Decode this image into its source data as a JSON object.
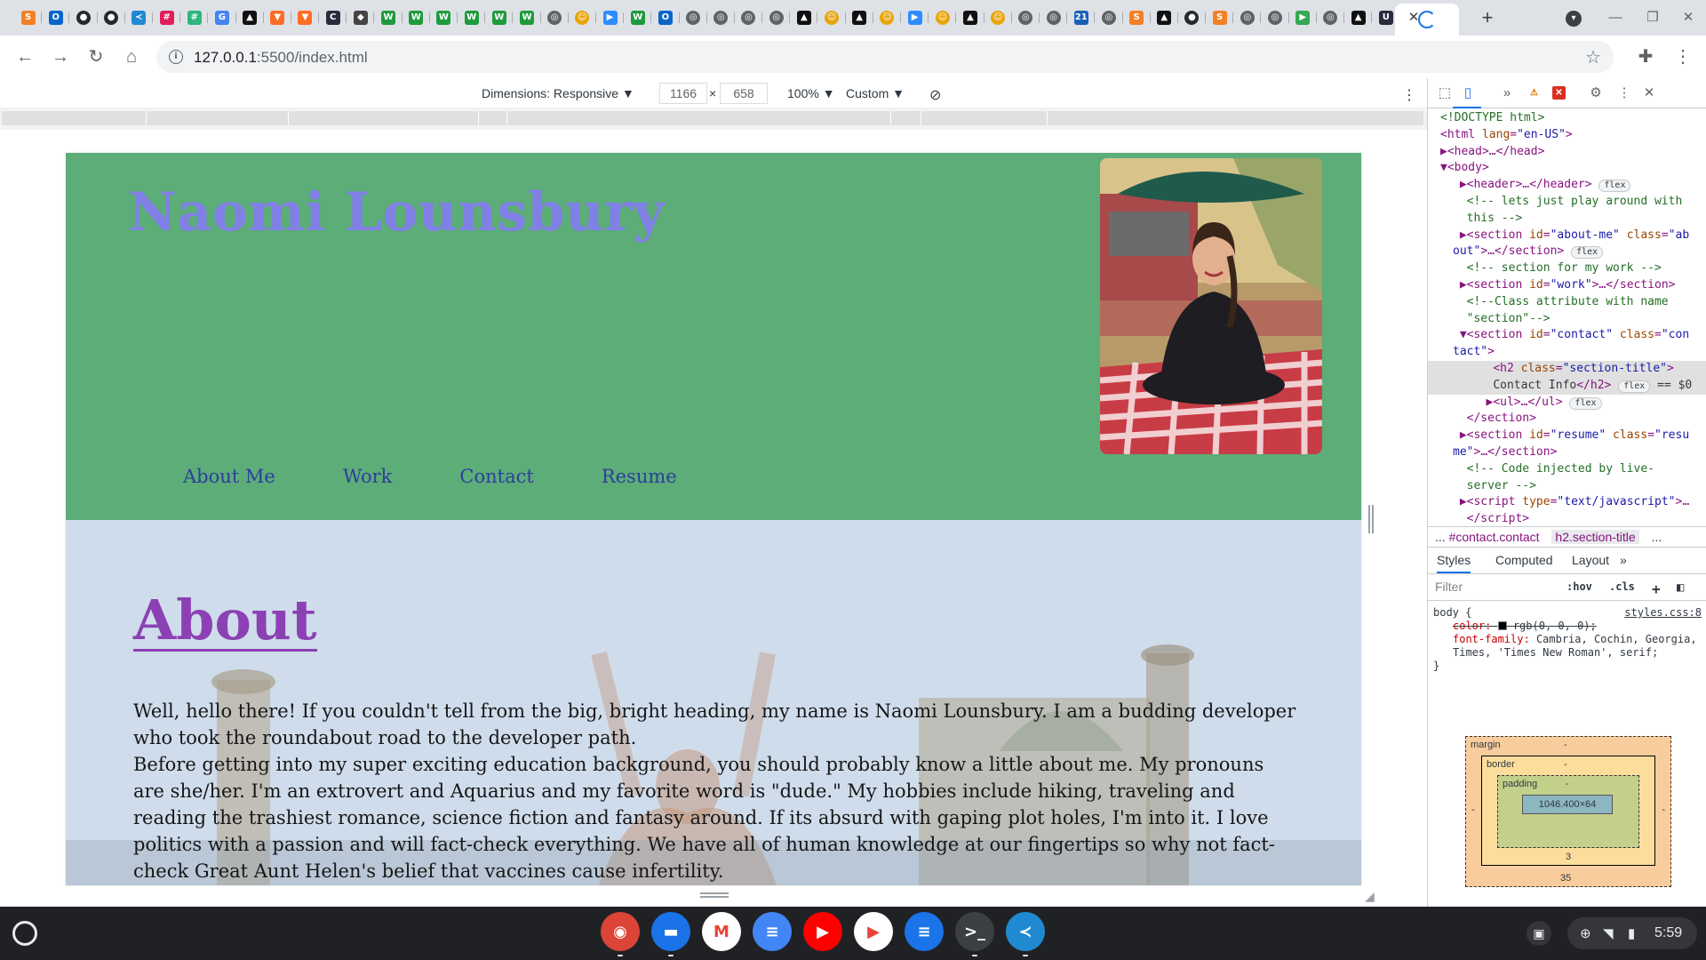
{
  "browser": {
    "tabs": [
      {
        "icon": "stackoverflow-icon",
        "glyph": "S",
        "color": "#f48024"
      },
      {
        "icon": "outlook-icon",
        "glyph": "O",
        "color": "#0a64c8"
      },
      {
        "icon": "github-icon",
        "glyph": "●",
        "color": "#24292e"
      },
      {
        "icon": "github-icon",
        "glyph": "●",
        "color": "#24292e"
      },
      {
        "icon": "vscode-icon",
        "glyph": "≺",
        "color": "#1f8ad2"
      },
      {
        "icon": "slack-icon",
        "glyph": "#",
        "color": "#e01e5a"
      },
      {
        "icon": "slack-icon",
        "glyph": "#",
        "color": "#2eb67d"
      },
      {
        "icon": "google-icon",
        "glyph": "G",
        "color": "#4285f4"
      },
      {
        "icon": "bookmark-icon",
        "glyph": "▲",
        "color": "#111111"
      },
      {
        "icon": "gitlab-icon",
        "glyph": "▼",
        "color": "#fc6d26"
      },
      {
        "icon": "gitlab-icon",
        "glyph": "▼",
        "color": "#fc6d26"
      },
      {
        "icon": "codewars-icon",
        "glyph": "C",
        "color": "#2b2b3f"
      },
      {
        "icon": "diamond-icon",
        "glyph": "◆",
        "color": "#444444"
      },
      {
        "icon": "wordpress-icon",
        "glyph": "W",
        "color": "#1e9b3c"
      },
      {
        "icon": "wordpress-icon",
        "glyph": "W",
        "color": "#1e9b3c"
      },
      {
        "icon": "wordpress-icon",
        "glyph": "W",
        "color": "#1e9b3c"
      },
      {
        "icon": "wordpress-icon",
        "glyph": "W",
        "color": "#1e9b3c"
      },
      {
        "icon": "wordpress-icon",
        "glyph": "W",
        "color": "#1e9b3c"
      },
      {
        "icon": "wordpress-icon",
        "glyph": "W",
        "color": "#1e9b3c"
      },
      {
        "icon": "globe-icon",
        "glyph": "◎",
        "color": "#5f6368"
      },
      {
        "icon": "emoji-icon",
        "glyph": "☺",
        "color": "#e8a50a"
      },
      {
        "icon": "zoom-icon",
        "glyph": "▶",
        "color": "#2d8cff"
      },
      {
        "icon": "wordpress-icon",
        "glyph": "W",
        "color": "#1e9b3c"
      },
      {
        "icon": "outlook-icon",
        "glyph": "O",
        "color": "#0a64c8"
      },
      {
        "icon": "globe-icon",
        "glyph": "◎",
        "color": "#5f6368"
      },
      {
        "icon": "globe-icon",
        "glyph": "◎",
        "color": "#5f6368"
      },
      {
        "icon": "globe-icon",
        "glyph": "◎",
        "color": "#5f6368"
      },
      {
        "icon": "globe-icon",
        "glyph": "◎",
        "color": "#5f6368"
      },
      {
        "icon": "bookmark-icon",
        "glyph": "▲",
        "color": "#111111"
      },
      {
        "icon": "emoji-icon",
        "glyph": "☺",
        "color": "#e8a50a"
      },
      {
        "icon": "bookmark-icon",
        "glyph": "▲",
        "color": "#111111"
      },
      {
        "icon": "emoji-icon",
        "glyph": "☺",
        "color": "#e8a50a"
      },
      {
        "icon": "zoom-icon",
        "glyph": "▶",
        "color": "#2d8cff"
      },
      {
        "icon": "emoji-icon",
        "glyph": "☺",
        "color": "#e8a50a"
      },
      {
        "icon": "bookmark-icon",
        "glyph": "▲",
        "color": "#111111"
      },
      {
        "icon": "emoji-icon",
        "glyph": "☺",
        "color": "#e8a50a"
      },
      {
        "icon": "globe-icon",
        "glyph": "◎",
        "color": "#5f6368"
      },
      {
        "icon": "globe-icon",
        "glyph": "◎",
        "color": "#5f6368"
      },
      {
        "icon": "twenty-one-icon",
        "glyph": "21",
        "color": "#1a5fb4"
      },
      {
        "icon": "globe-icon",
        "glyph": "◎",
        "color": "#5f6368"
      },
      {
        "icon": "stackoverflow-icon",
        "glyph": "S",
        "color": "#f48024"
      },
      {
        "icon": "bookmark-icon",
        "glyph": "▲",
        "color": "#111111"
      },
      {
        "icon": "github-icon",
        "glyph": "●",
        "color": "#24292e"
      },
      {
        "icon": "stackoverflow-icon",
        "glyph": "S",
        "color": "#f48024"
      },
      {
        "icon": "globe-icon",
        "glyph": "◎",
        "color": "#5f6368"
      },
      {
        "icon": "globe-icon",
        "glyph": "◎",
        "color": "#5f6368"
      },
      {
        "icon": "play-icon",
        "glyph": "▶",
        "color": "#34a853"
      },
      {
        "icon": "globe-icon",
        "glyph": "◎",
        "color": "#5f6368"
      },
      {
        "icon": "bookmark-icon",
        "glyph": "▲",
        "color": "#111111"
      },
      {
        "icon": "codepen-icon",
        "glyph": "U",
        "color": "#2b2b3f"
      },
      {
        "icon": "codepen-icon",
        "glyph": "U",
        "color": "#2b2b3f"
      }
    ],
    "close_label": "✕",
    "new_tab_label": "+",
    "url_host": "127.0.0.1",
    "url_path": ":5500/index.html"
  },
  "device_toolbar": {
    "dimensions_label": "Dimensions: Responsive ▼",
    "width": "1166",
    "times": "×",
    "height": "658",
    "zoom": "100% ▼",
    "throttle": "Custom ▼"
  },
  "site": {
    "name": "Naomi Lounsbury",
    "nav": [
      "About Me",
      "Work",
      "Contact",
      "Resume"
    ],
    "about_title": "About",
    "about_p1": "Well, hello there! If you couldn't tell from the big, bright heading, my name is Naomi Lounsbury. I am a budding developer who took the roundabout road to the developer path.",
    "about_p2": "Before getting into my super exciting education background, you should probably know a little about me. My pronouns are she/her. I'm an extrovert and Aquarius and my favorite word is \"dude.\" My hobbies include hiking, traveling and reading the trashiest romance, science fiction and fantasy around. If its absurd with gaping plot holes, I'm into it. I love politics with a passion and will fact-check everything. We have all of human knowledge at our fingertips so why not fact-check Great Aunt Helen's belief that vaccines cause infertility."
  },
  "devtools": {
    "elements": [
      {
        "html": "<span class='cmt'>&lt;!DOCTYPE html&gt;</span>",
        "indent": 1
      },
      {
        "html": "<span class='tag'>&lt;html</span> <span class='attr'>lang</span>=<span class='val'>\"en-US\"</span><span class='tag'>&gt;</span>",
        "indent": 1
      },
      {
        "html": "▶<span class='tag'>&lt;head&gt;</span>…<span class='tag'>&lt;/head&gt;</span>",
        "indent": 1
      },
      {
        "html": "▼<span class='tag'>&lt;body&gt;</span>",
        "indent": 1
      },
      {
        "html": " ▶<span class='tag'>&lt;header&gt;</span>…<span class='tag'>&lt;/header&gt;</span> <span class='badge'>flex</span>",
        "indent": 2
      },
      {
        "html": "  <span class='cmt'>&lt;!-- lets just play around with</span>",
        "indent": 2
      },
      {
        "html": "  <span class='cmt'>this --&gt;</span>",
        "indent": 2
      },
      {
        "html": " ▶<span class='tag'>&lt;section</span> <span class='attr'>id</span>=<span class='val'>\"about-me\"</span> <span class='attr'>class</span>=<span class='val'>\"ab</span>",
        "indent": 2
      },
      {
        "html": "<span class='val'>out\"</span><span class='tag'>&gt;</span>…<span class='tag'>&lt;/section&gt;</span> <span class='badge'>flex</span>",
        "indent": 2
      },
      {
        "html": "  <span class='cmt'>&lt;!-- section for my work --&gt;</span>",
        "indent": 2
      },
      {
        "html": " ▶<span class='tag'>&lt;section</span> <span class='attr'>id</span>=<span class='val'>\"work\"</span><span class='tag'>&gt;</span>…<span class='tag'>&lt;/section&gt;</span>",
        "indent": 2
      },
      {
        "html": "  <span class='cmt'>&lt;!--Class attribute with name</span>",
        "indent": 2
      },
      {
        "html": "  <span class='cmt'>\"section\"--&gt;</span>",
        "indent": 2
      },
      {
        "html": " ▼<span class='tag'>&lt;section</span> <span class='attr'>id</span>=<span class='val'>\"contact\"</span> <span class='attr'>class</span>=<span class='val'>\"con</span>",
        "indent": 2
      },
      {
        "html": "<span class='val'>tact\"</span><span class='tag'>&gt;</span>",
        "indent": 2
      },
      {
        "html": "    <span class='tag'>&lt;h2</span> <span class='attr'>class</span>=<span class='val'>\"section-title\"</span><span class='tag'>&gt;</span>",
        "indent": 3,
        "selected": true
      },
      {
        "html": "    <span class='txt'>Contact Info</span><span class='tag'>&lt;/h2&gt;</span> <span class='badge'>flex</span> <span class='txt'>== $0</span>",
        "indent": 3,
        "selected": true
      },
      {
        "html": "   ▶<span class='tag'>&lt;ul&gt;</span>…<span class='tag'>&lt;/ul&gt;</span> <span class='badge'>flex</span>",
        "indent": 3
      },
      {
        "html": "  <span class='tag'>&lt;/section&gt;</span>",
        "indent": 2
      },
      {
        "html": " ▶<span class='tag'>&lt;section</span> <span class='attr'>id</span>=<span class='val'>\"resume\"</span> <span class='attr'>class</span>=<span class='val'>\"resu</span>",
        "indent": 2
      },
      {
        "html": "<span class='val'>me\"</span><span class='tag'>&gt;</span>…<span class='tag'>&lt;/section&gt;</span>",
        "indent": 2
      },
      {
        "html": "  <span class='cmt'>&lt;!-- Code injected by live-</span>",
        "indent": 2
      },
      {
        "html": "  <span class='cmt'>server --&gt;</span>",
        "indent": 2
      },
      {
        "html": " ▶<span class='tag'>&lt;script</span> <span class='attr'>type</span>=<span class='val'>\"text/javascript\"</span><span class='tag'>&gt;</span>…",
        "indent": 2
      },
      {
        "html": "  <span class='tag'>&lt;/script&gt;</span>",
        "indent": 2
      }
    ],
    "crumb_more": "...",
    "crumb_1": "#contact.contact",
    "crumb_2": "h2.section-title",
    "crumb_end": "...",
    "tabs": [
      "Styles",
      "Computed",
      "Layout"
    ],
    "more_tabs": "»",
    "filter_placeholder": "Filter",
    "hov": ":hov",
    "cls": ".cls",
    "rule_selector": "body {",
    "rule_source": "styles.css:8",
    "rule_color_prop": "color:",
    "rule_color_val": "rgb(0, 0, 0);",
    "rule_font_prop": "font-family:",
    "rule_font_val": "Cambria, Cochin, Georgia, Times, 'Times New Roman', serif;",
    "rule_close": "}",
    "box_model": {
      "margin_label": "margin",
      "margin_value": "-",
      "margin_bottom": "35",
      "border_label": "border",
      "border_value": "-",
      "border_bottom": "3",
      "padding_label": "padding",
      "padding_value": "-",
      "content": "1046.400×64"
    }
  },
  "shelf": {
    "apps": [
      {
        "name": "chrome-app-icon",
        "glyph": "◉",
        "color": "#db4437"
      },
      {
        "name": "files-app-icon",
        "glyph": "▬",
        "color": "#1a73e8"
      },
      {
        "name": "gmail-app-icon",
        "glyph": "M",
        "color": "#ffffff"
      },
      {
        "name": "docs-app-icon",
        "glyph": "≡",
        "color": "#4285f4"
      },
      {
        "name": "youtube-app-icon",
        "glyph": "▶",
        "color": "#ff0000"
      },
      {
        "name": "play-store-app-icon",
        "glyph": "▶",
        "color": "#ffffff"
      },
      {
        "name": "messages-app-icon",
        "glyph": "≡",
        "color": "#1a73e8"
      },
      {
        "name": "terminal-app-icon",
        "glyph": ">_",
        "color": "#3c4043"
      },
      {
        "name": "vscode-app-icon",
        "glyph": "≺",
        "color": "#1f8ad2"
      }
    ],
    "time": "5:59"
  }
}
